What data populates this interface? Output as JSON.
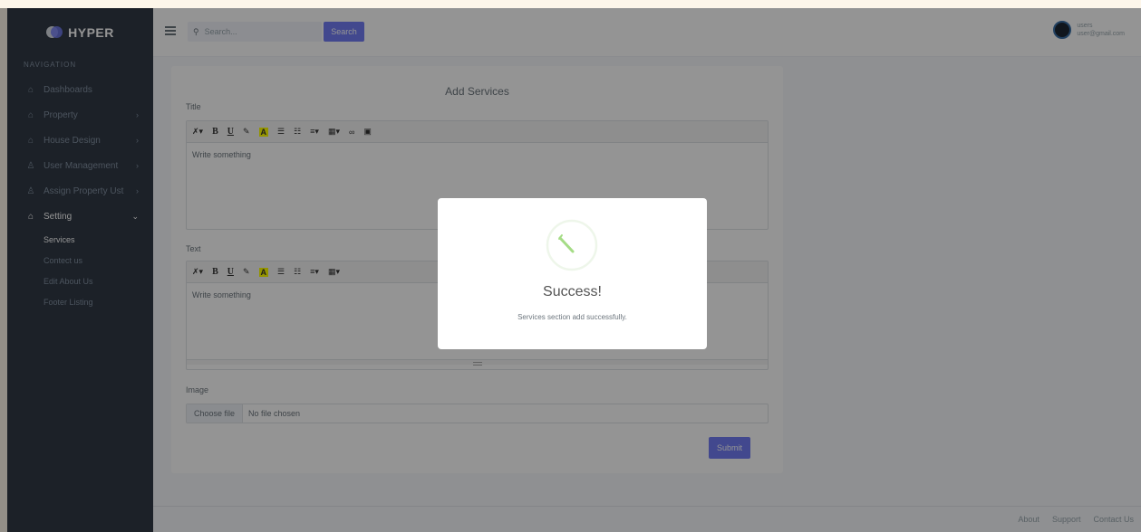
{
  "brand": {
    "name": "HYPER"
  },
  "sidebar": {
    "section_title": "NAVIGATION",
    "items": [
      {
        "label": "Dashboards",
        "icon": "home-icon",
        "has_chevron": false
      },
      {
        "label": "Property",
        "icon": "home-icon",
        "has_chevron": true
      },
      {
        "label": "House Design",
        "icon": "home-icon",
        "has_chevron": true
      },
      {
        "label": "User Management",
        "icon": "user-icon",
        "has_chevron": true
      },
      {
        "label": "Assign Property Ust",
        "icon": "user-icon",
        "has_chevron": true
      },
      {
        "label": "Setting",
        "icon": "home-icon",
        "has_chevron": true,
        "active": true
      }
    ],
    "sub_items": [
      {
        "label": "Services",
        "active": true
      },
      {
        "label": "Contect us"
      },
      {
        "label": "Edit About Us"
      },
      {
        "label": "Footer Listing"
      }
    ]
  },
  "topbar": {
    "search_placeholder": "Search...",
    "search_button": "Search",
    "user_name": "users",
    "user_email": "user@gmail.com"
  },
  "form": {
    "title": "Add Services",
    "title_label": "Title",
    "text_label": "Text",
    "image_label": "Image",
    "editor_placeholder": "Write something",
    "file_button": "Choose file",
    "file_status": "No file chosen",
    "submit": "Submit"
  },
  "footer": {
    "links": [
      "About",
      "Support",
      "Contact Us"
    ]
  },
  "modal": {
    "title": "Success!",
    "message": "Services section add successfully."
  },
  "colors": {
    "primary": "#727cf5",
    "sidebar_bg": "#313a46",
    "success": "#a5dc86"
  }
}
